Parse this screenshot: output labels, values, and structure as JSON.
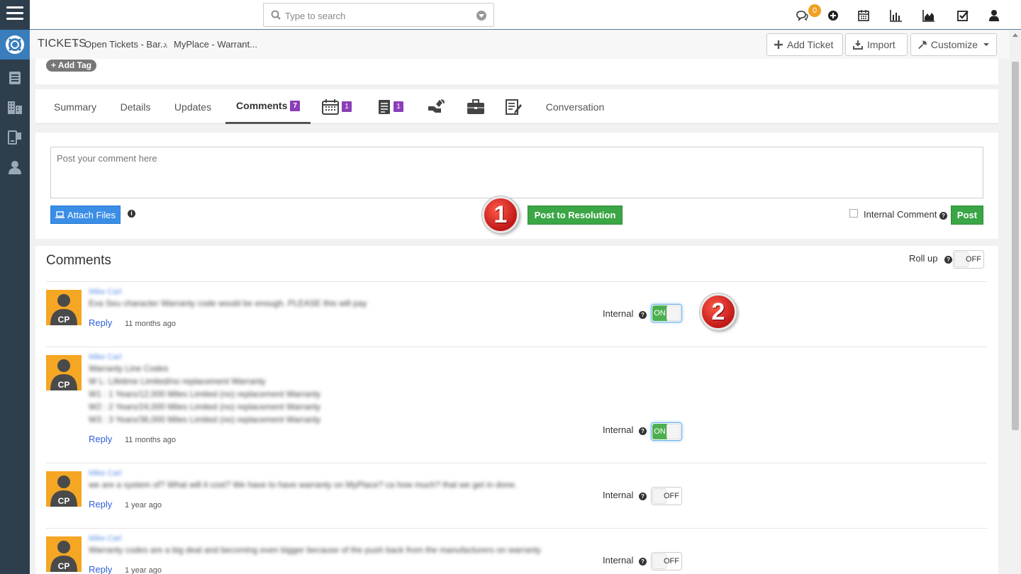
{
  "sidebar": {
    "items": [
      {
        "icon": "menu-icon"
      },
      {
        "icon": "support-lifebuoy-icon",
        "active": true
      },
      {
        "icon": "document-list-icon"
      },
      {
        "icon": "building-icon"
      },
      {
        "icon": "device-icon"
      },
      {
        "icon": "user-icon"
      }
    ]
  },
  "topbar": {
    "search_placeholder": "Type to search",
    "notification_count": "0",
    "icons": [
      "chat-icon",
      "plus-circle-icon",
      "calendar-icon",
      "bar-chart-icon",
      "area-chart-icon",
      "checkbox-icon",
      "user-icon"
    ]
  },
  "breadcrumb": {
    "root": "TICKETS",
    "items": [
      "Open Tickets - Bar...",
      "MyPlace - Warrant..."
    ]
  },
  "toolbar": {
    "add_ticket": "Add Ticket",
    "import": "Import",
    "customize": "Customize"
  },
  "tags": {
    "add_tag": "Add Tag"
  },
  "tabs": [
    {
      "label": "Summary"
    },
    {
      "label": "Details"
    },
    {
      "label": "Updates"
    },
    {
      "label": "Comments",
      "badge": "7",
      "active": true
    },
    {
      "icon": "calendar-icon",
      "badge": "1"
    },
    {
      "icon": "notes-icon",
      "badge": "1"
    },
    {
      "icon": "tools-icon"
    },
    {
      "icon": "briefcase-icon"
    },
    {
      "icon": "edit-document-icon"
    },
    {
      "label": "Conversation"
    }
  ],
  "composer": {
    "placeholder": "Post your comment here",
    "attach_files": "Attach Files",
    "post_to_resolution": "Post to Resolution",
    "internal_comment": "Internal Comment",
    "post": "Post"
  },
  "markers": [
    "1",
    "2"
  ],
  "comments_section": {
    "title": "Comments",
    "rollup_label": "Roll up",
    "rollup_state": "OFF",
    "internal_label": "Internal",
    "reply_label": "Reply",
    "avatar_initials": "CP",
    "items": [
      {
        "author": "Mike Carl",
        "lines": [
          "Eva Seu character Warranty code would be enough. PLEASE this will pay"
        ],
        "time": "11 months ago",
        "internal": "ON"
      },
      {
        "author": "Mike Carl",
        "lines": [
          "Warranty Line Codes",
          "W L: Lifetime Limited/no replacement Warranty",
          "W1 : 1 Years/12,000 Miles Limited (no) replacement Warranty",
          "W2 : 2 Years/24,000 Miles Limited (no) replacement Warranty",
          "W3 : 3 Years/36,000 Miles Limited (no) replacement Warranty"
        ],
        "time": "11 months ago",
        "internal": "ON"
      },
      {
        "author": "Mike Carl",
        "lines": [
          "we are a system of? What will it cost? We have to have warranty on MyPlace? ca how much? that we get in done."
        ],
        "time": "1 year ago",
        "internal": "OFF"
      },
      {
        "author": "Mike Carl",
        "lines": [
          "Warranty codes are a big deal and becoming even bigger because of the push back from the manufacturers on warranty"
        ],
        "time": "1 year ago",
        "internal": "OFF"
      }
    ]
  }
}
